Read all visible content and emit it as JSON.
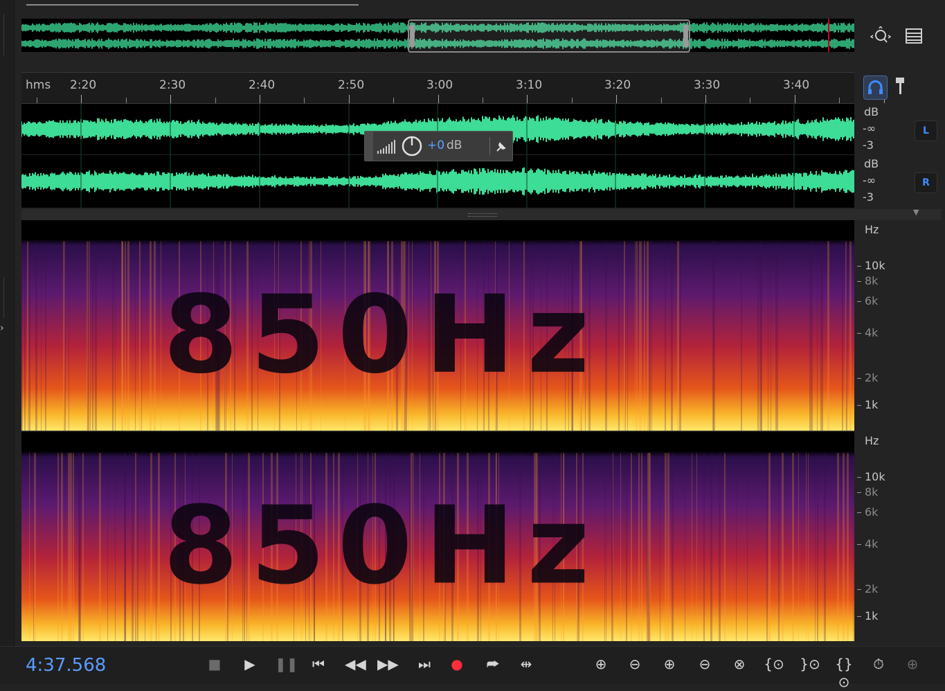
{
  "ruler": {
    "unit_label": "hms",
    "ticks": [
      "2:20",
      "2:30",
      "2:40",
      "2:50",
      "3:00",
      "3:10",
      "3:20",
      "3:30",
      "3:40"
    ]
  },
  "hud": {
    "gain_value": "+0",
    "gain_unit": "dB"
  },
  "channels": [
    {
      "label": "L",
      "db_unit": "dB",
      "db_inf": "-∞",
      "db_minus3": "-3"
    },
    {
      "label": "R",
      "db_unit": "dB",
      "db_inf": "-∞",
      "db_minus3": "-3"
    }
  ],
  "spectral": {
    "unit": "Hz",
    "labels": [
      "10k",
      "8k",
      "6k",
      "4k",
      "2k",
      "1k"
    ],
    "overlay_text": "850Hz"
  },
  "transport": {
    "timecode": "4:37.568"
  },
  "icons": {
    "zoom_navigator": "zoom-navigator-icon",
    "panel_menu": "panel-menu-icon",
    "headphones": "headphones-icon",
    "marker": "marker-pin-icon"
  },
  "colors": {
    "waveform": "#3ddc97",
    "accent": "#3f8bff",
    "record": "#ff2e3a"
  }
}
